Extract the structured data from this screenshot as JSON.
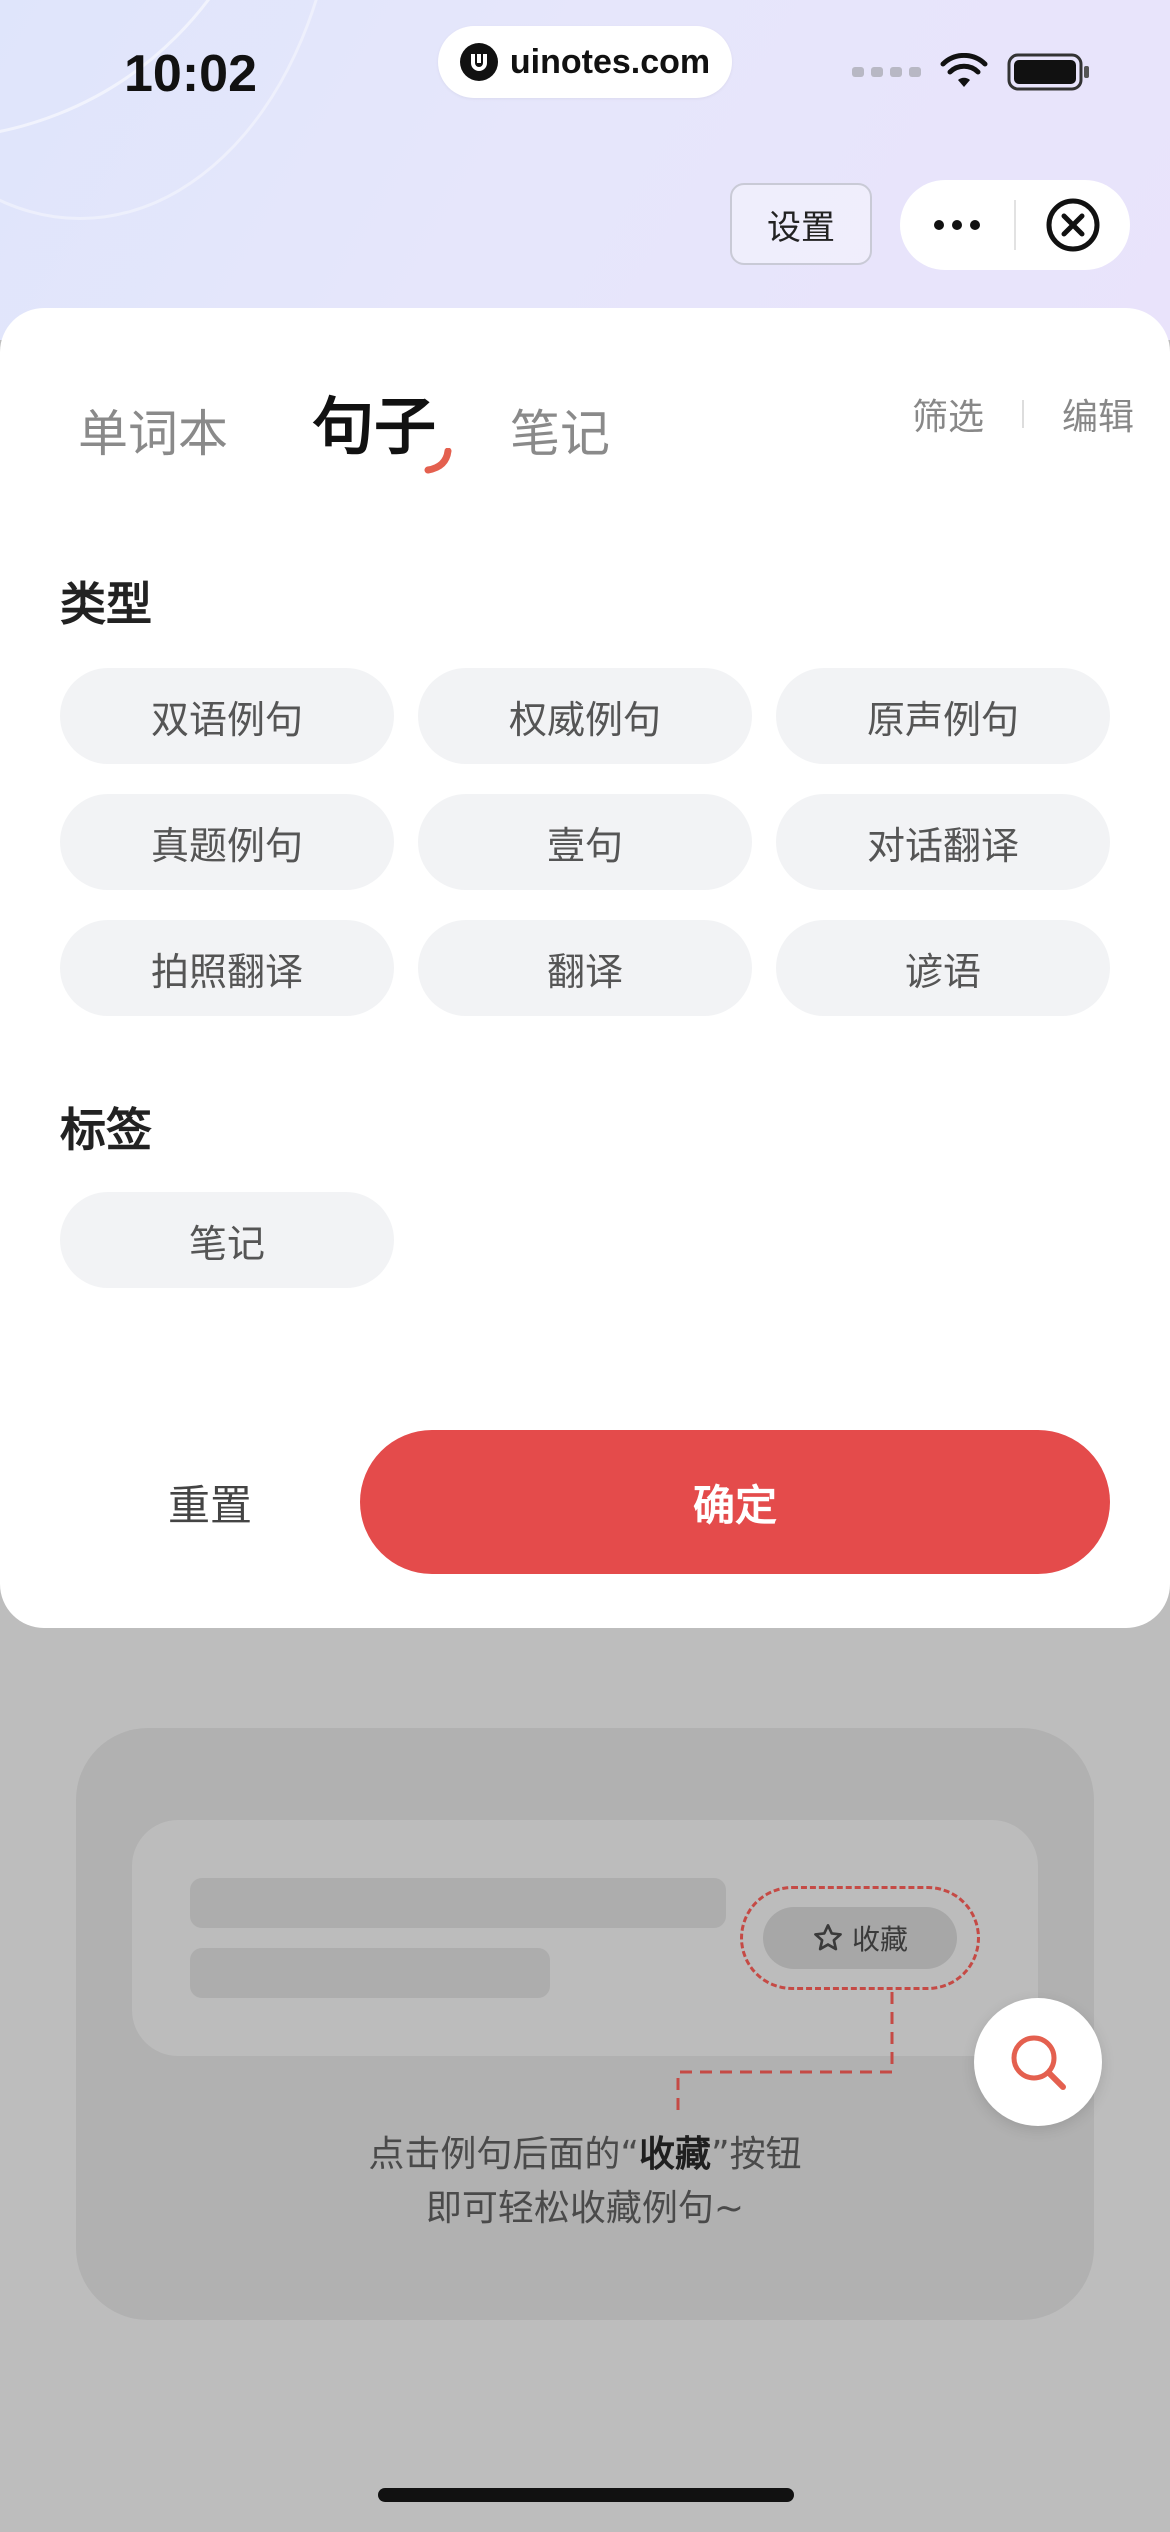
{
  "status_bar": {
    "time": "10:02",
    "url": "uinotes.com"
  },
  "header": {
    "settings_label": "设置"
  },
  "tabs": [
    {
      "label": "单词本",
      "active": false
    },
    {
      "label": "句子",
      "active": true
    },
    {
      "label": "笔记",
      "active": false
    }
  ],
  "tools": {
    "filter_label": "筛选",
    "edit_label": "编辑"
  },
  "filter": {
    "type_title": "类型",
    "types": [
      "双语例句",
      "权威例句",
      "原声例句",
      "真题例句",
      "壹句",
      "对话翻译",
      "拍照翻译",
      "翻译",
      "谚语"
    ],
    "tag_title": "标签",
    "tags": [
      "笔记"
    ],
    "reset_label": "重置",
    "confirm_label": "确定"
  },
  "empty_state": {
    "collect_label": "收藏",
    "line1_prefix": "点击例句后面的“",
    "line1_bold": "收藏",
    "line1_suffix": "”按钮",
    "line2": "即可轻松收藏例句~"
  },
  "colors": {
    "accent": "#e44b4b",
    "chip_bg": "#f2f3f5",
    "overlay": "#bdbdbd"
  },
  "icons": [
    "uinotes-logo-icon",
    "wifi-icon",
    "battery-icon",
    "more-icon",
    "close-circle-icon",
    "star-icon",
    "search-icon"
  ]
}
